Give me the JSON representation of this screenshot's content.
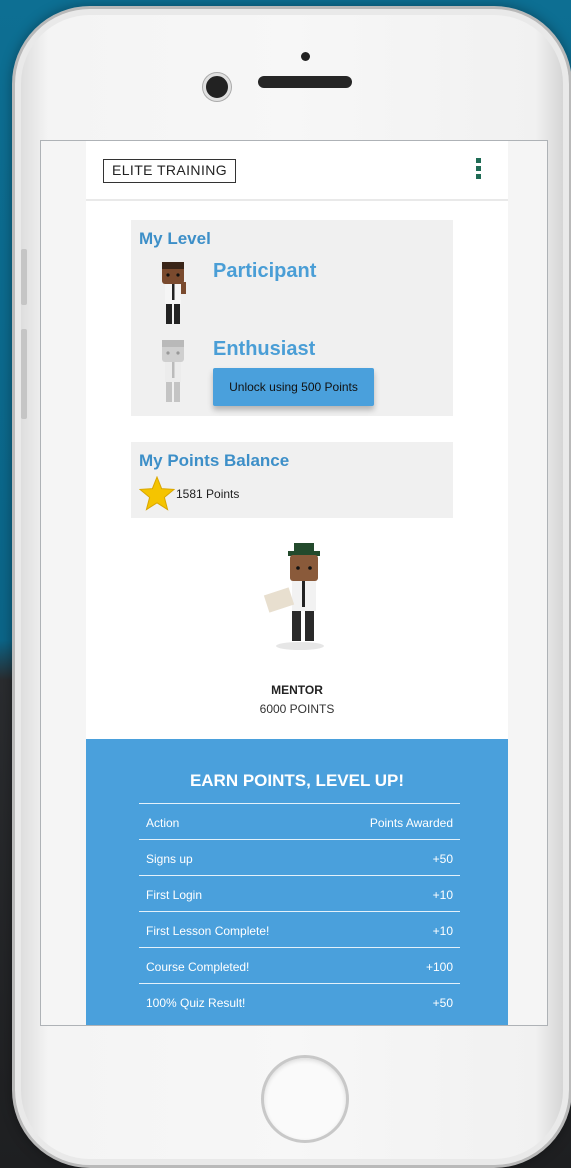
{
  "brand": {
    "logo_text": "ELITE TRAINING"
  },
  "my_level": {
    "title": "My Level",
    "current_level": "Participant",
    "next_level": "Enthusiast",
    "unlock_button": "Unlock using 500 Points"
  },
  "points_balance": {
    "title": "My Points Balance",
    "points_text": "1581 Points"
  },
  "featured_level": {
    "name": "MENTOR",
    "points": "6000 POINTS"
  },
  "earn_points": {
    "title": "EARN POINTS, LEVEL UP!",
    "headers": {
      "action": "Action",
      "points": "Points Awarded"
    },
    "rows": [
      {
        "action": "Signs up",
        "points": "+50"
      },
      {
        "action": "First Login",
        "points": "+10"
      },
      {
        "action": "First Lesson Complete!",
        "points": "+10"
      },
      {
        "action": "Course Completed!",
        "points": "+100"
      },
      {
        "action": "100% Quiz Result!",
        "points": "+50"
      }
    ]
  },
  "colors": {
    "accent": "#4aa0dc",
    "title_blue": "#3d8fc8",
    "menu_dots": "#1f6b55",
    "star": "#f5c400"
  },
  "icons": [
    "menu-dots-icon",
    "star-icon"
  ]
}
